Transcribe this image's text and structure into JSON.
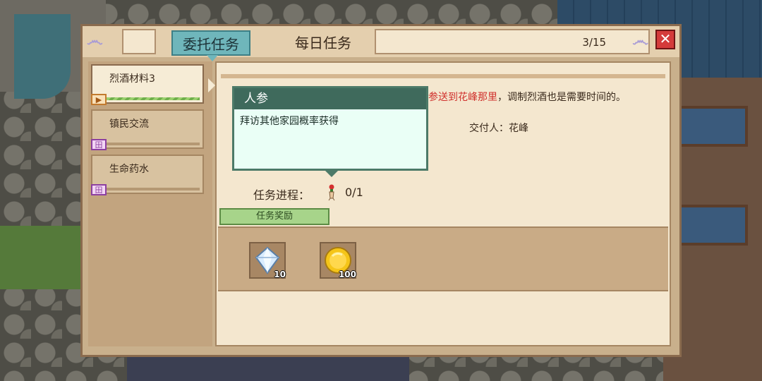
{
  "tabs": {
    "commission": "委托任务",
    "daily": "每日任务"
  },
  "counter": "3/15",
  "close_symbol": "✕",
  "quests": [
    {
      "label": "烈酒材料3",
      "icon": "flag-icon",
      "icon_glyph": "▶"
    },
    {
      "label": "镇民交流",
      "icon": "building-icon",
      "icon_glyph": "田"
    },
    {
      "label": "生命药水",
      "icon": "building-icon",
      "icon_glyph": "田"
    }
  ],
  "detail": {
    "desc_highlight": "参送到花峰那里",
    "desc_rest": "，调制烈酒也是需要时间的。",
    "giver": "交付人：花峰",
    "progress_label": "任务进程：",
    "progress_value": "0/1",
    "reward_tab": "任务奖励",
    "rewards": [
      {
        "icon": "diamond-icon",
        "qty": "10"
      },
      {
        "icon": "gold-coin-icon",
        "qty": "100"
      }
    ]
  },
  "tooltip": {
    "title": "人参",
    "body": "拜访其他家园概率获得"
  }
}
